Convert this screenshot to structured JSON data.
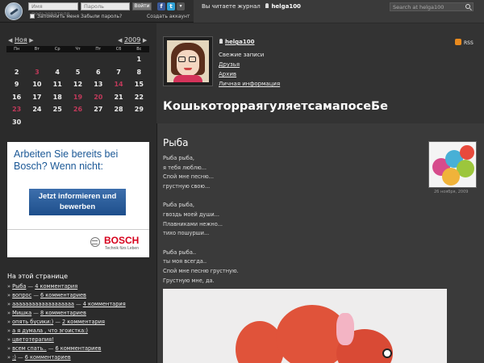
{
  "topbar": {
    "username_placeholder": "Имя пользователя",
    "password_placeholder": "Пароль",
    "login_button": "Войти",
    "remember_me": "Запомнить меня",
    "forgot_password": "Забыли пароль?",
    "create_account": "Создать аккаунт",
    "reading_label": "Вы читаете журнал",
    "reading_user": "helga100",
    "search_placeholder": "Search at helga100"
  },
  "calendar": {
    "month": "Ноя",
    "year": "2009",
    "weekdays": [
      "Пн",
      "Вт",
      "Ср",
      "Чт",
      "Пт",
      "Сб",
      "Вс"
    ],
    "weeks": [
      [
        "",
        "",
        "",
        "",
        "",
        "",
        "1"
      ],
      [
        "2",
        "3",
        "4",
        "5",
        "6",
        "7",
        "8"
      ],
      [
        "9",
        "10",
        "11",
        "12",
        "13",
        "14",
        "15"
      ],
      [
        "16",
        "17",
        "18",
        "19",
        "20",
        "21",
        "22"
      ],
      [
        "23",
        "24",
        "25",
        "26",
        "27",
        "28",
        "29"
      ],
      [
        "30",
        "",
        "",
        "",
        "",
        "",
        ""
      ]
    ],
    "highlighted_days": [
      "3",
      "14",
      "19",
      "20",
      "23",
      "26"
    ]
  },
  "ad": {
    "headline": "Arbeiten Sie bereits bei Bosch? Wenn nicht:",
    "button": "Jetzt informieren und bewerben",
    "brand": "BOSCH",
    "tagline": "Technik fürs Leben",
    "brand_color": "#d6001c"
  },
  "sidebar": {
    "page_title": "На этой странице",
    "entries": [
      {
        "title": "Рыба",
        "comments": "4 комментария"
      },
      {
        "title": "вопрос",
        "comments": "6 комментариев"
      },
      {
        "title": "ааааааааааааааааааа",
        "comments": "4 комментария"
      },
      {
        "title": "Мишка",
        "comments": "8 комментариев"
      },
      {
        "title": "опять бусики:)",
        "comments": "2 комментария"
      },
      {
        "title": "а я думала , что эгоистка:)",
        "comments": ""
      },
      {
        "title": "цветотерапия!",
        "comments": ""
      },
      {
        "title": "всем спать..",
        "comments": "6 комментариев"
      },
      {
        "title": ":)",
        "comments": "6 комментариев"
      }
    ]
  },
  "journal": {
    "user": "helga100",
    "links": [
      "Свежие записи",
      "Друзья",
      "Архив",
      "Личная информация"
    ],
    "rss": "RSS",
    "title": "КошькоторраягуляетсамапосеБе"
  },
  "post": {
    "title": "Рыба",
    "stanzas": [
      [
        "Рыба рыба,",
        "я тебя люблю...",
        "Спой мне песню...",
        "грустную свою..."
      ],
      [
        "Рыба рыба,",
        "гвоздь моей души...",
        "Плавниками нежно...",
        "тихо пошурши..."
      ],
      [
        "Рыба рыба..",
        "ты моя всегда..",
        "Спой мне песню грустную.",
        "Грустную мне, да."
      ]
    ],
    "thumb_date": "26 ноября, 2009"
  }
}
